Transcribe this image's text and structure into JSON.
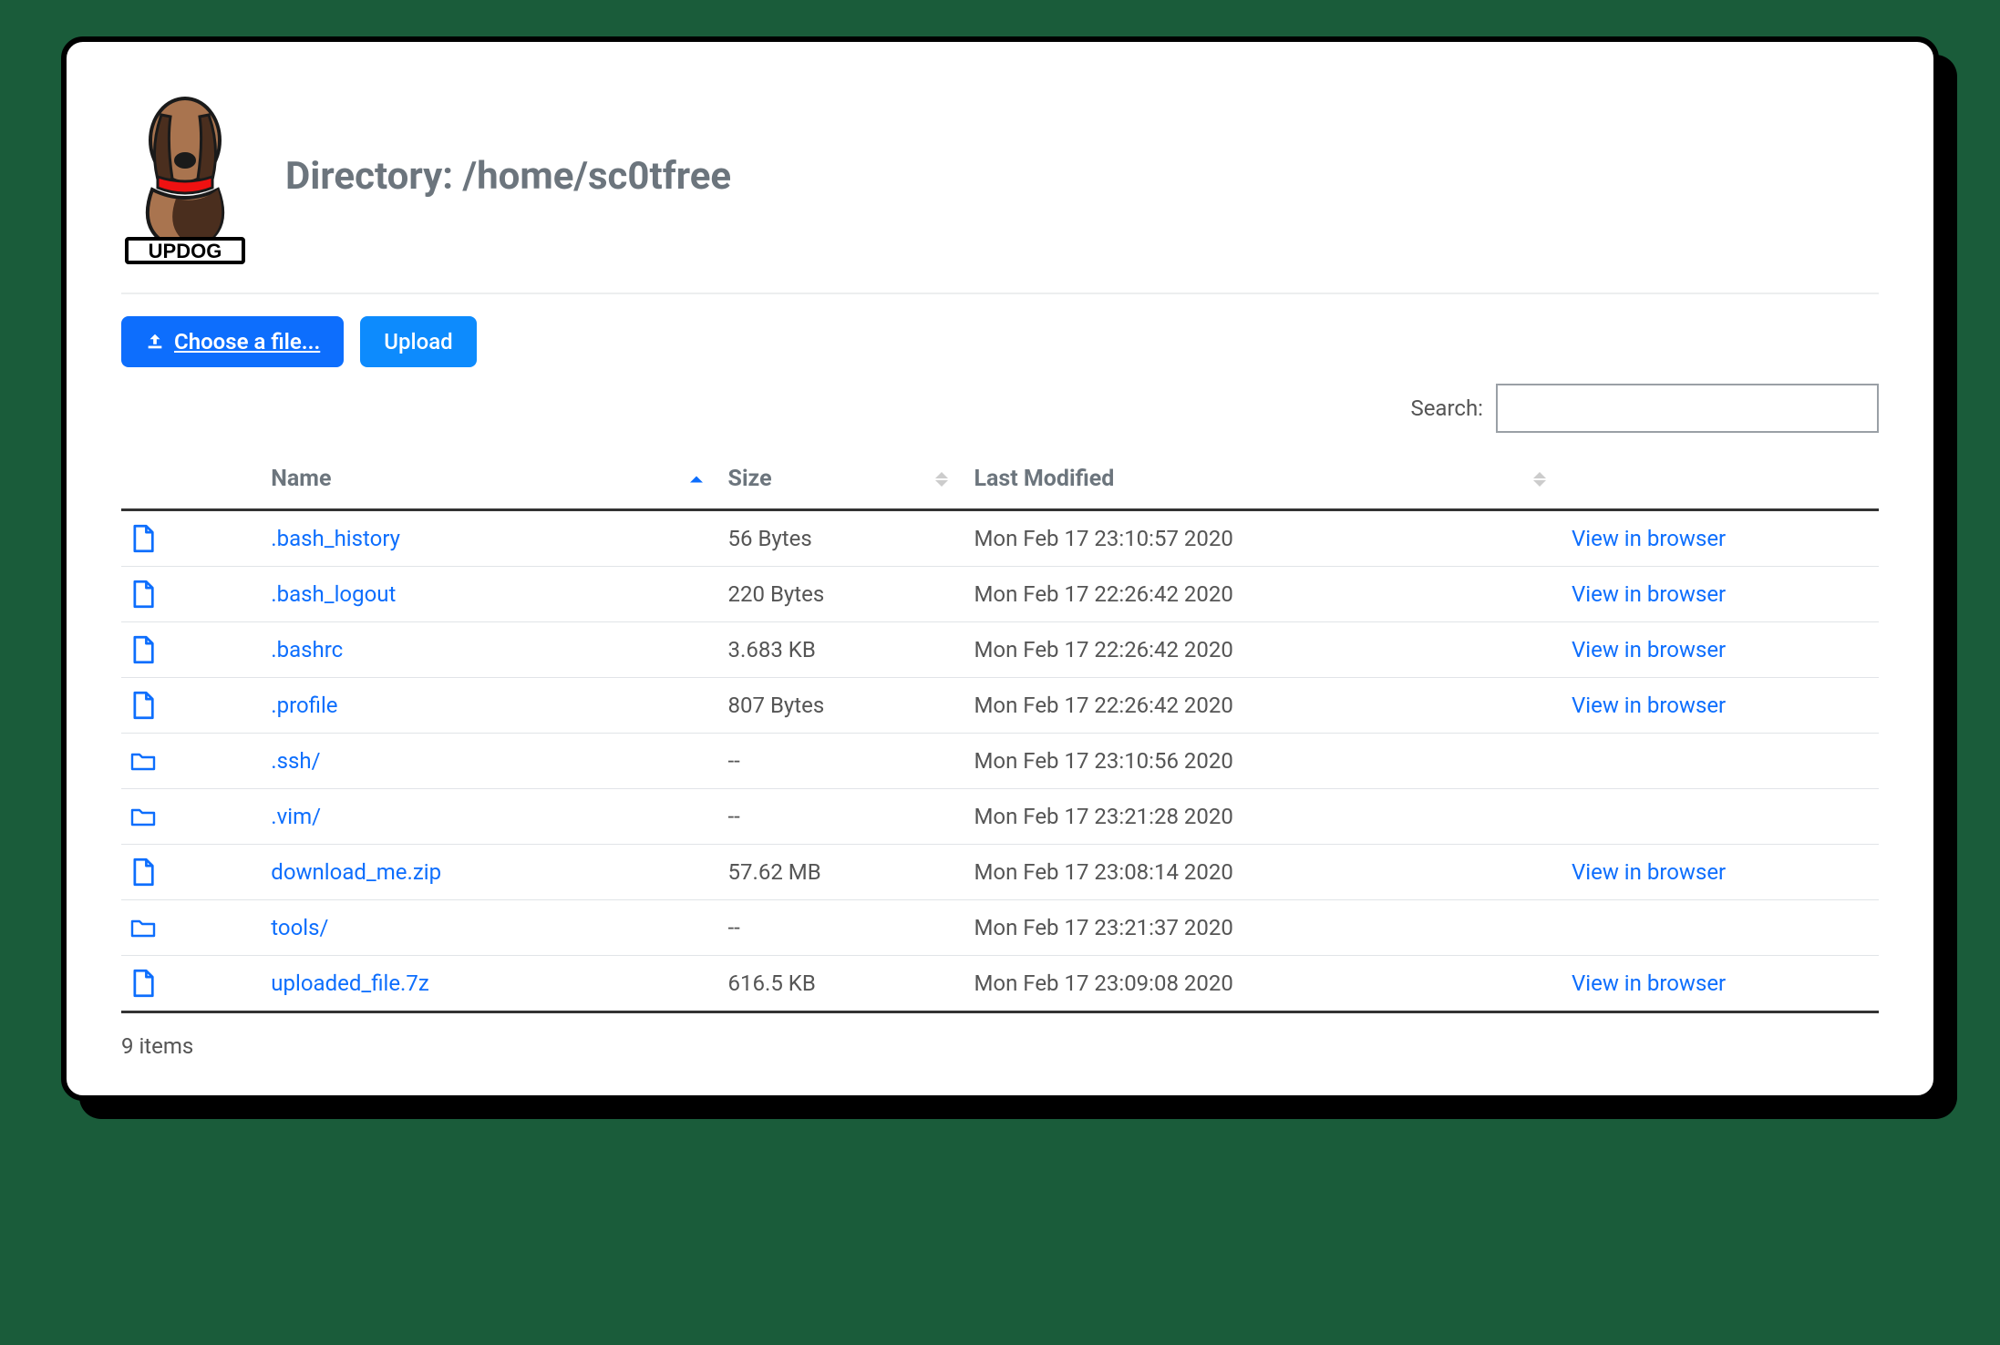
{
  "brand": "UPDOG",
  "title": "Directory: /home/sc0tfree",
  "toolbar": {
    "choose_label": "Choose a file...",
    "upload_label": "Upload"
  },
  "search": {
    "label": "Search:",
    "value": ""
  },
  "columns": {
    "name": "Name",
    "size": "Size",
    "modified": "Last Modified"
  },
  "view_label": "View in browser",
  "rows": [
    {
      "type": "file",
      "name": ".bash_history",
      "size": "56 Bytes",
      "modified": "Mon Feb 17 23:10:57 2020",
      "view": true
    },
    {
      "type": "file",
      "name": ".bash_logout",
      "size": "220 Bytes",
      "modified": "Mon Feb 17 22:26:42 2020",
      "view": true
    },
    {
      "type": "file",
      "name": ".bashrc",
      "size": "3.683 KB",
      "modified": "Mon Feb 17 22:26:42 2020",
      "view": true
    },
    {
      "type": "file",
      "name": ".profile",
      "size": "807 Bytes",
      "modified": "Mon Feb 17 22:26:42 2020",
      "view": true
    },
    {
      "type": "folder",
      "name": ".ssh/",
      "size": "--",
      "modified": "Mon Feb 17 23:10:56 2020",
      "view": false
    },
    {
      "type": "folder",
      "name": ".vim/",
      "size": "--",
      "modified": "Mon Feb 17 23:21:28 2020",
      "view": false
    },
    {
      "type": "file",
      "name": "download_me.zip",
      "size": "57.62 MB",
      "modified": "Mon Feb 17 23:08:14 2020",
      "view": true
    },
    {
      "type": "folder",
      "name": "tools/",
      "size": "--",
      "modified": "Mon Feb 17 23:21:37 2020",
      "view": false
    },
    {
      "type": "file",
      "name": "uploaded_file.7z",
      "size": "616.5 KB",
      "modified": "Mon Feb 17 23:09:08 2020",
      "view": true
    }
  ],
  "footer_count": "9 items"
}
